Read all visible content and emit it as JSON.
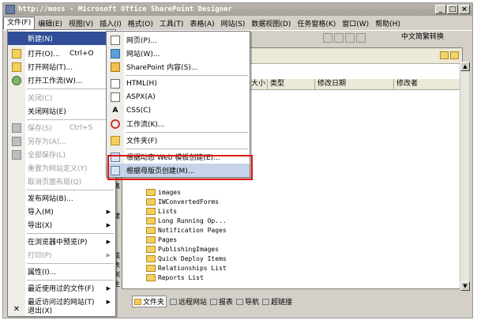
{
  "window": {
    "title": "http://moss - Microsoft Office SharePoint Designer",
    "controls": [
      "_",
      "□",
      "×"
    ]
  },
  "menubar": [
    "文件(F)",
    "编辑(E)",
    "视图(V)",
    "插入(I)",
    "格式(O)",
    "工具(T)",
    "表格(A)",
    "网站(S)",
    "数据视图(D)",
    "任务窗格(K)",
    "窗口(W)",
    "帮助(H)"
  ],
  "toolbar": {
    "language_select": "中文简繁转换"
  },
  "file_menu": [
    {
      "label": "新建(N)",
      "shortcut": "",
      "arrow": true,
      "state": "highlighted",
      "icon": "new-icon"
    },
    {
      "label": "打开(O)...",
      "shortcut": "Ctrl+O",
      "arrow": false,
      "state": "normal",
      "icon": "open-folder-icon"
    },
    {
      "label": "打开网站(T)...",
      "shortcut": "",
      "arrow": false,
      "state": "normal",
      "icon": "open-site-icon"
    },
    {
      "label": "打开工作流(W)...",
      "shortcut": "",
      "arrow": false,
      "state": "normal",
      "icon": "workflow-icon"
    },
    {
      "label": "关闭(C)",
      "shortcut": "",
      "arrow": false,
      "state": "disabled",
      "icon": ""
    },
    {
      "label": "关闭网站(E)",
      "shortcut": "",
      "arrow": false,
      "state": "normal",
      "icon": ""
    },
    {
      "label": "保存(S)",
      "shortcut": "Ctrl+S",
      "arrow": false,
      "state": "disabled",
      "icon": "save-icon"
    },
    {
      "label": "另存为(A)...",
      "shortcut": "",
      "arrow": false,
      "state": "disabled",
      "icon": "save-as-icon"
    },
    {
      "label": "全部保存(L)",
      "shortcut": "",
      "arrow": false,
      "state": "disabled",
      "icon": "save-all-icon"
    },
    {
      "label": "重置为网站定义(Y)",
      "shortcut": "",
      "arrow": false,
      "state": "disabled",
      "icon": ""
    },
    {
      "label": "取消页面布局(Q)",
      "shortcut": "",
      "arrow": false,
      "state": "disabled",
      "icon": ""
    },
    {
      "label": "发布网站(B)...",
      "shortcut": "",
      "arrow": false,
      "state": "normal",
      "icon": ""
    },
    {
      "label": "导入(M)",
      "shortcut": "",
      "arrow": true,
      "state": "normal",
      "icon": ""
    },
    {
      "label": "导出(X)",
      "shortcut": "",
      "arrow": true,
      "state": "normal",
      "icon": ""
    },
    {
      "label": "在浏览器中预览(P)",
      "shortcut": "",
      "arrow": true,
      "state": "normal",
      "icon": ""
    },
    {
      "label": "打印(P)",
      "shortcut": "",
      "arrow": true,
      "state": "disabled",
      "icon": ""
    },
    {
      "label": "属性(I)...",
      "shortcut": "",
      "arrow": false,
      "state": "normal",
      "icon": ""
    },
    {
      "label": "最近使用过的文件(F)",
      "shortcut": "",
      "arrow": true,
      "state": "normal",
      "icon": ""
    },
    {
      "label": "最近访问过的网站(T)",
      "shortcut": "",
      "arrow": true,
      "state": "normal",
      "icon": ""
    },
    {
      "label": "退出(X)",
      "shortcut": "",
      "arrow": false,
      "state": "normal",
      "icon": "exit-icon"
    }
  ],
  "new_submenu": [
    {
      "label": "网页(P)...",
      "icon": "page-icon"
    },
    {
      "label": "网站(W)...",
      "icon": "site-icon"
    },
    {
      "label": "SharePoint 内容(S)...",
      "icon": "sharepoint-icon"
    },
    {
      "label": "HTML(H)",
      "icon": "html-icon"
    },
    {
      "label": "ASPX(A)",
      "icon": "aspx-icon"
    },
    {
      "label": "CSS(C)",
      "icon": "css-icon"
    },
    {
      "label": "工作流(K)...",
      "icon": "workflow-icon"
    },
    {
      "label": "文件夹(F)",
      "icon": "folder-icon"
    },
    {
      "label": "根据动态 Web 模板创建(E)...",
      "icon": "template-icon"
    },
    {
      "label": "根据母版页创建(M)...",
      "icon": "master-page-icon"
    }
  ],
  "columns": [
    "大小",
    "类型",
    "修改日期",
    "修改者"
  ],
  "file_list": [
    "images",
    "IWConvertedForms",
    "Lists",
    "Long Running Op...",
    "Notification Pages",
    "Pages",
    "PublishingImages",
    "Quick Deploy Items",
    "Relationships List",
    "Reports List"
  ],
  "bottom_tabs": [
    "文件夹",
    "远程网站",
    "报表",
    "导航",
    "超链接"
  ],
  "side_fragments": [
    "携",
    "拔",
    "成",
    "表",
    "浏",
    "主"
  ]
}
